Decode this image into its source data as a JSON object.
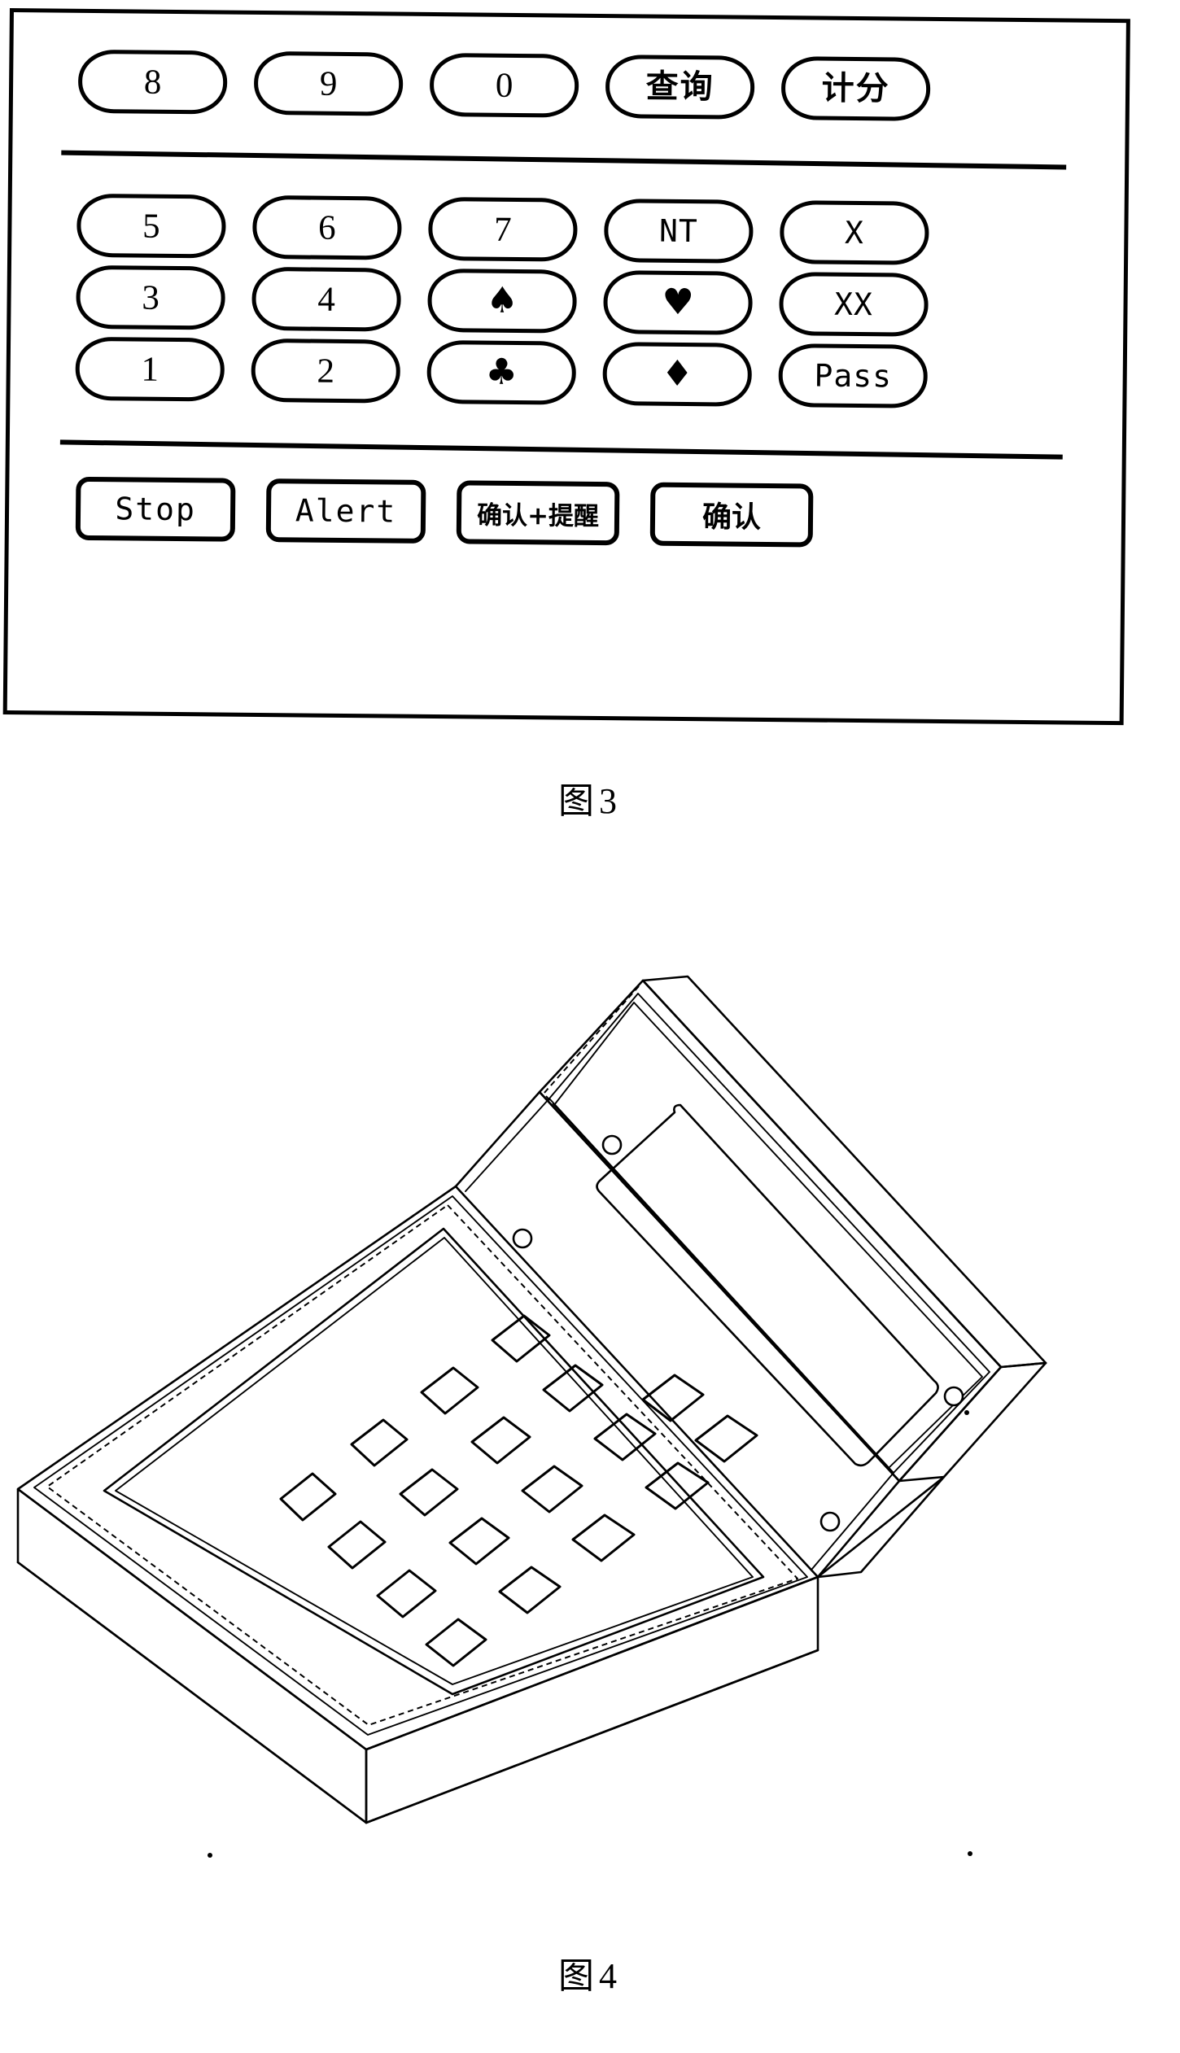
{
  "document": {
    "type": "patent-drawing-sheet",
    "ink_color": "#000000",
    "background_color": "#ffffff"
  },
  "figure3": {
    "caption_label": "图",
    "caption_number": "3",
    "description": "bridge bidding keypad face plate",
    "panel_border_color": "#000000",
    "rows": [
      {
        "name": "top-row",
        "keys": [
          {
            "label": "8",
            "kind": "digit"
          },
          {
            "label": "9",
            "kind": "digit"
          },
          {
            "label": "0",
            "kind": "digit"
          },
          {
            "label": "查询",
            "kind": "cjk"
          },
          {
            "label": "计分",
            "kind": "cjk"
          }
        ]
      },
      {
        "name": "row-5-6-7-nt-x",
        "keys": [
          {
            "label": "5",
            "kind": "digit"
          },
          {
            "label": "6",
            "kind": "digit"
          },
          {
            "label": "7",
            "kind": "digit"
          },
          {
            "label": "NT",
            "kind": "mono"
          },
          {
            "label": "X",
            "kind": "mono"
          }
        ]
      },
      {
        "name": "row-3-4-spade-heart-xx",
        "keys": [
          {
            "label": "3",
            "kind": "digit"
          },
          {
            "label": "4",
            "kind": "digit"
          },
          {
            "label": "♠",
            "kind": "suit",
            "icon": "spade-icon"
          },
          {
            "label": "♥",
            "kind": "suit",
            "icon": "heart-icon"
          },
          {
            "label": "XX",
            "kind": "mono"
          }
        ]
      },
      {
        "name": "row-1-2-club-diamond-pass",
        "keys": [
          {
            "label": "1",
            "kind": "digit"
          },
          {
            "label": "2",
            "kind": "digit"
          },
          {
            "label": "♣",
            "kind": "suit",
            "icon": "club-icon"
          },
          {
            "label": "♦",
            "kind": "suit",
            "icon": "diamond-icon"
          },
          {
            "label": "Pass",
            "kind": "mono"
          }
        ]
      }
    ],
    "command_row": {
      "name": "command-row",
      "buttons": [
        {
          "label": "Stop",
          "kind": "latin"
        },
        {
          "label": "Alert",
          "kind": "latin"
        },
        {
          "label": "确认+提醒",
          "kind": "cjk"
        },
        {
          "label": "确认",
          "kind": "cjk"
        }
      ]
    },
    "separators": 2
  },
  "figure4": {
    "caption_label": "图",
    "caption_number": "4",
    "description": "isometric view of the clamshell bidding box, lid open, showing display screen and keypad",
    "parts": {
      "lid": "display-lid",
      "screen": "display-screen",
      "base": "keypad-base",
      "keys": "keypad-keys",
      "screws": "bezel-screws"
    },
    "keypad_key_count": 18,
    "screw_count": 4
  }
}
